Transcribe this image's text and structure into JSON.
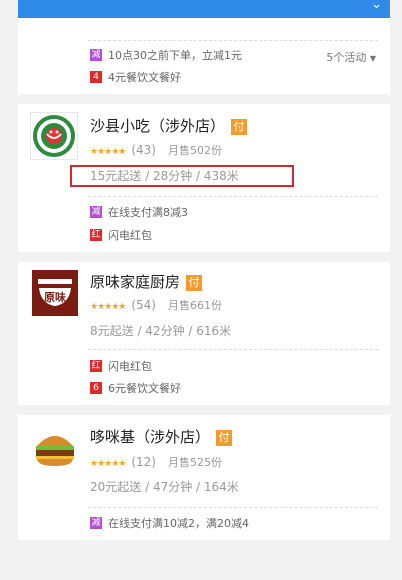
{
  "header": {
    "chevron_icon": "chevron-down-icon"
  },
  "top_partial": {
    "promos": [
      {
        "badge": "减",
        "badge_color": "#b44ed6",
        "text": "10点30之前下单，立减1元"
      },
      {
        "badge": "4",
        "badge_color": "#e02a2a",
        "text": "4元餐饮文餐好"
      }
    ],
    "more_label": "5个活动",
    "more_icon": "triangle-down-icon"
  },
  "shops": [
    {
      "name": "沙县小吃（涉外店）",
      "pay_badge": "付",
      "stars": "★★★★★",
      "rating_count": "(43)",
      "sales": "月售502份",
      "delivery": "15元起送 / 28分钟 / 438米",
      "highlighted": true,
      "promos": [
        {
          "badge": "减",
          "badge_color": "#b44ed6",
          "text": "在线支付满8减3"
        },
        {
          "badge": "红",
          "badge_color": "#e02a2a",
          "text": "闪电红包"
        }
      ]
    },
    {
      "name": "原味家庭厨房",
      "pay_badge": "付",
      "stars": "★★★★★",
      "rating_count": "(54)",
      "sales": "月售661份",
      "delivery": "8元起送 / 42分钟 / 616米",
      "logo_text": "原味",
      "promos": [
        {
          "badge": "红",
          "badge_color": "#e02a2a",
          "text": "闪电红包"
        },
        {
          "badge": "6",
          "badge_color": "#e02a2a",
          "text": "6元餐饮文餐好"
        }
      ]
    },
    {
      "name": "哆咪基（涉外店）",
      "pay_badge": "付",
      "stars": "★★★★★",
      "rating_count": "(12)",
      "sales": "月售525份",
      "delivery": "20元起送 / 47分钟 / 164米",
      "promos": [
        {
          "badge": "减",
          "badge_color": "#b44ed6",
          "text": "在线支付满10减2，满20减4"
        }
      ]
    }
  ]
}
